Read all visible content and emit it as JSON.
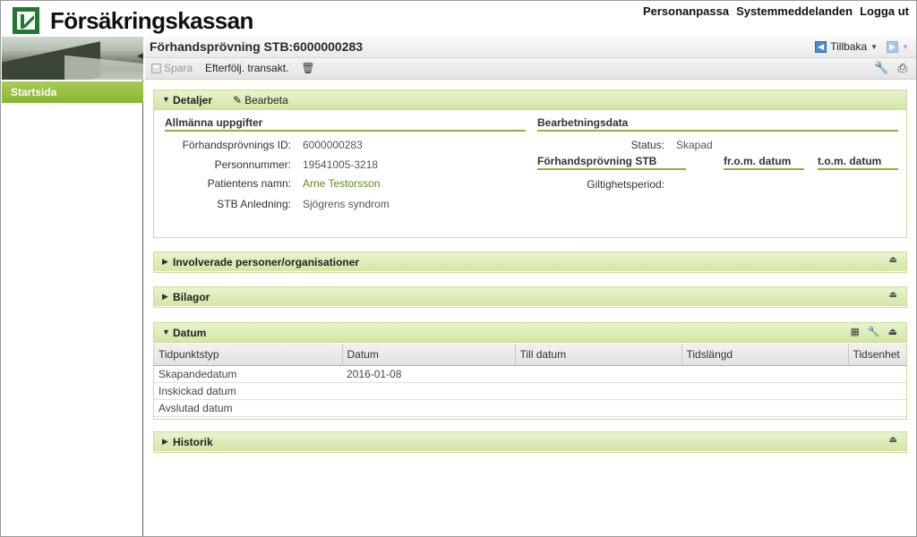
{
  "brand": {
    "name": "Försäkringskassan"
  },
  "top_links": [
    "Personanpassa",
    "Systemmeddelanden",
    "Logga ut"
  ],
  "sidebar": {
    "items": [
      {
        "label": "Startsida"
      }
    ]
  },
  "header": {
    "title": "Förhandsprövning STB:6000000283",
    "back_label": "Tillbaka"
  },
  "toolbar": {
    "save_label": "Spara",
    "followup_label": "Efterfölj. transakt."
  },
  "detaljer": {
    "title": "Detaljer",
    "edit_label": "Bearbeta",
    "general": {
      "title": "Allmänna uppgifter",
      "fields": [
        {
          "label": "Förhandsprövnings ID:",
          "value": "6000000283"
        },
        {
          "label": "Personnummer:",
          "value": "19541005-3218"
        },
        {
          "label": "Patientens namn:",
          "value": "Arne Testorsson"
        },
        {
          "label": "STB Anledning:",
          "value": "Sjögrens syndrom"
        }
      ]
    },
    "processing": {
      "title": "Bearbetningsdata",
      "status_label": "Status:",
      "status_value": "Skapad",
      "stb_title": "Förhandsprövning STB",
      "from_label": "fr.o.m. datum",
      "to_label": "t.o.m. datum",
      "validity_label": "Giltighetsperiod:"
    }
  },
  "panels": {
    "involverade": "Involverade personer/organisationer",
    "bilagor": "Bilagor",
    "datum": "Datum",
    "historik": "Historik"
  },
  "datum_table": {
    "columns": [
      "Tidpunktstyp",
      "Datum",
      "Till datum",
      "Tidslängd",
      "Tidsenhet"
    ],
    "rows": [
      [
        "Skapandedatum",
        "2016-01-08",
        "",
        "",
        ""
      ],
      [
        "Inskickad datum",
        "",
        "",
        "",
        ""
      ],
      [
        "Avslutad datum",
        "",
        "",
        "",
        ""
      ]
    ]
  },
  "colors": {
    "accent_green": "#8bb532",
    "panel_header": "#d3e6a2",
    "link_green": "#5c8a1c"
  }
}
